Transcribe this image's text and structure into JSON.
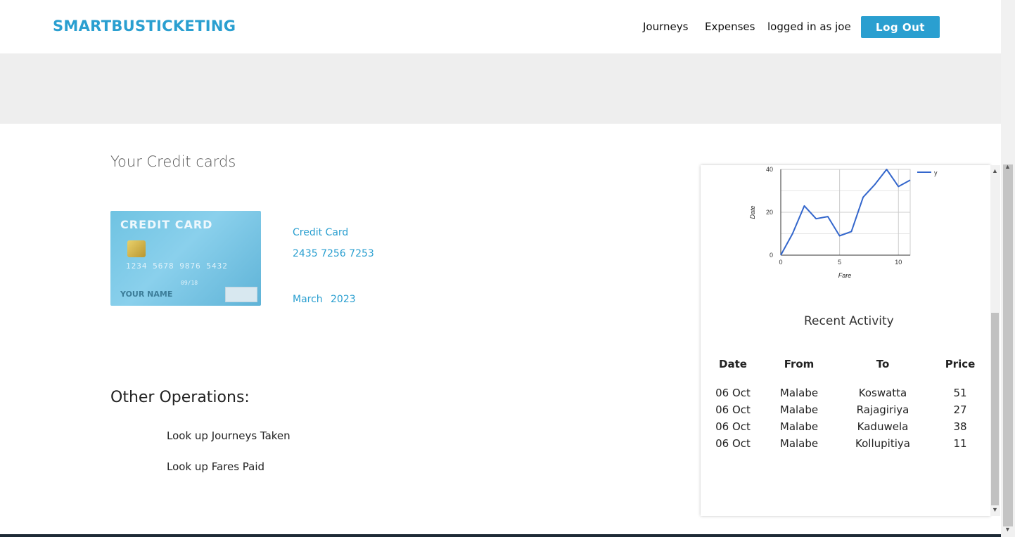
{
  "navbar": {
    "brand": "SMARTBUSTICKETING",
    "links": [
      "Journeys",
      "Expenses",
      "logged in as joe"
    ],
    "logout_label": "Log Out"
  },
  "credit_cards": {
    "title": "Your Credit cards",
    "card_image": {
      "header": "CREDIT CARD",
      "number": "1234 5678 9876 5432",
      "expiry": "09/18",
      "name": "YOUR NAME"
    },
    "card_type": "Credit Card",
    "card_number": "2435 7256 7253",
    "expiry_month": "March",
    "expiry_year": "2023"
  },
  "other_operations": {
    "title": "Other Operations:",
    "items": [
      "Look up Journeys Taken",
      "Look up Fares Paid"
    ]
  },
  "chart_data": {
    "type": "line",
    "xlabel": "Fare",
    "ylabel": "Date",
    "xlim": [
      0,
      11
    ],
    "ylim": [
      0,
      40
    ],
    "x_ticks": [
      "0",
      "5",
      "10"
    ],
    "y_ticks": [
      "0",
      "20",
      "40"
    ],
    "grid": true,
    "legend": "top-right",
    "series": [
      {
        "name": "y",
        "color": "#3366cc",
        "x": [
          0,
          1,
          2,
          3,
          4,
          5,
          6,
          7,
          8,
          9,
          10,
          11
        ],
        "values": [
          0,
          10,
          23,
          17,
          18,
          9,
          11,
          27,
          33,
          40,
          32,
          35
        ]
      }
    ]
  },
  "recent_activity": {
    "title": "Recent Activity",
    "headers": [
      "Date",
      "From",
      "To",
      "Price"
    ],
    "rows": [
      [
        "06 Oct",
        "Malabe",
        "Koswatta",
        "51"
      ],
      [
        "06 Oct",
        "Malabe",
        "Rajagiriya",
        "27"
      ],
      [
        "06 Oct",
        "Malabe",
        "Kaduwela",
        "38"
      ],
      [
        "06 Oct",
        "Malabe",
        "Kollupitiya",
        "11"
      ]
    ]
  },
  "colors": {
    "accent": "#2a9fd0",
    "banner": "#eeeeee",
    "series": "#3366cc"
  }
}
